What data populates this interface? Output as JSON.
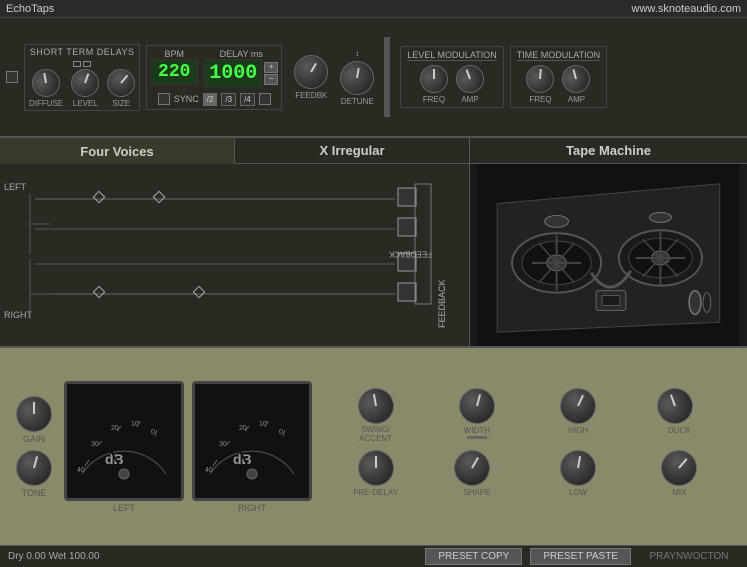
{
  "titlebar": {
    "left": "EchoTaps",
    "right": "www.sknoteaudio.com"
  },
  "top": {
    "short_term_delays_label": "SHORT TERM DELAYS",
    "knobs": {
      "diffuse_label": "DIFFUSE",
      "level_label": "LEVEL",
      "size_label": "SIZE"
    },
    "bpm_label": "BPM",
    "bpm_value": "220",
    "delay_ms_label": "DELAY ms",
    "delay_value": "1000",
    "sync_label": "SYNC",
    "feedbk_label": "FEEDBK",
    "detune_label": "DETUNE",
    "division_buttons": [
      "/2",
      "/3",
      "/4"
    ],
    "level_mod_label": "LEVEL MODULATION",
    "level_mod_freq_label": "FREQ",
    "level_mod_amp_label": "AMP",
    "time_mod_label": "TIME MODULATION",
    "time_mod_freq_label": "FREQ",
    "time_mod_amp_label": "AMP"
  },
  "middle": {
    "tab1_label": "Four Voices",
    "tab2_label": "X Irregular",
    "tape_label": "Tape Machine",
    "left_label": "LEFT",
    "right_label": "RIGHT",
    "feedback_label": "FEEDBACK"
  },
  "bottom": {
    "gain_label": "GAIN",
    "tone_label": "TONE",
    "left_meter_label": "LEFT",
    "right_meter_label": "RIGHT",
    "db_label": "dB",
    "knobs": {
      "swing_accent_label": "SWING/\nACCENT",
      "width_label": "WIDTH",
      "high_label": "HIGH",
      "duck_label": "DUCK",
      "pre_delay_label": "PRE-DELAY",
      "shape_label": "SHAPE",
      "low_label": "LOW",
      "mix_label": "MIX"
    }
  },
  "statusbar": {
    "status_text": "Dry 0.00  Wet 100.00",
    "preset_copy_label": "PRESET COPY",
    "preset_paste_label": "PRESET PASTE",
    "preset_name": "PRAYNWOCTON"
  }
}
